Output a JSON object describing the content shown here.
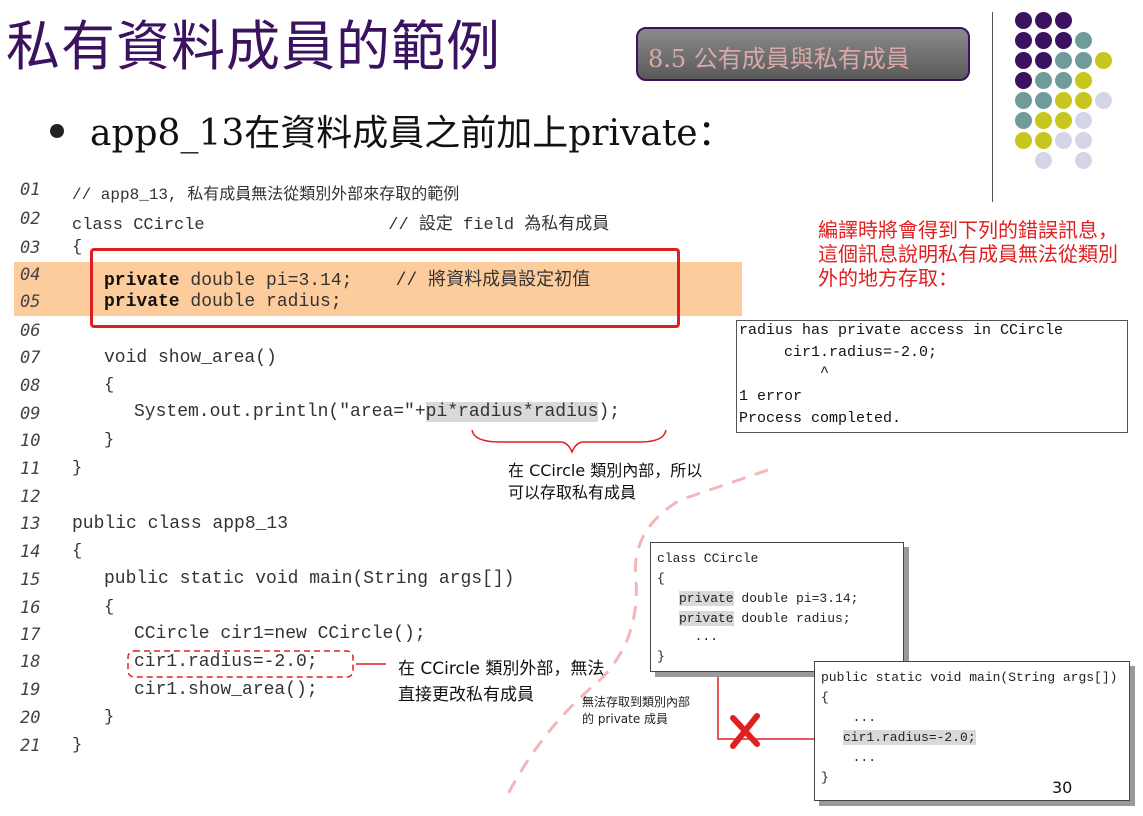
{
  "title": "私有資料成員的範例",
  "section_badge": "8.5  公有成員與私有成員",
  "subtitle": "app8_13在資料成員之前加上private：",
  "code_lines": [
    {
      "num": "01",
      "text": "// app8_13, 私有成員無法從類別外部來存取的範例"
    },
    {
      "num": "02",
      "text": "class CCircle                  // 設定 field 為私有成員"
    },
    {
      "num": "03",
      "text": "{"
    },
    {
      "num": "04",
      "kw": "private",
      "text": " double pi=3.14;    // 將資料成員設定初值"
    },
    {
      "num": "05",
      "kw": "private",
      "text": " double radius;"
    },
    {
      "num": "06",
      "text": ""
    },
    {
      "num": "07",
      "text": "void show_area()"
    },
    {
      "num": "08",
      "text": "{"
    },
    {
      "num": "09",
      "pre": "System.out.println(\"area=\"+",
      "hl": "pi*radius*radius",
      "post": ");"
    },
    {
      "num": "10",
      "text": "}"
    },
    {
      "num": "11",
      "text": "}"
    },
    {
      "num": "12",
      "text": ""
    },
    {
      "num": "13",
      "text": "public class app8_13"
    },
    {
      "num": "14",
      "text": "{"
    },
    {
      "num": "15",
      "text": "public static void main(String args[])"
    },
    {
      "num": "16",
      "text": "{"
    },
    {
      "num": "17",
      "text": "CCircle cir1=new CCircle();"
    },
    {
      "num": "18",
      "text": "cir1.radius=-2.0;"
    },
    {
      "num": "19",
      "text": "cir1.show_area();"
    },
    {
      "num": "20",
      "text": "}"
    },
    {
      "num": "21",
      "text": "}"
    }
  ],
  "error_note": "編譯時將會得到下列的錯誤訊息，這個訊息說明私有成員無法從類別外的地方存取：",
  "error_output": [
    "radius has private access in CCircle",
    "     cir1.radius=-2.0;",
    "         ^",
    "1 error",
    "Process completed."
  ],
  "inside_note_1": "在 CCircle 類別內部，所以",
  "inside_note_2": "可以存取私有成員",
  "outside_note_1": "在 CCircle 類別外部，無法",
  "outside_note_2": "直接更改私有成員",
  "popup_class": {
    "l1": "class CCircle",
    "l2": "{",
    "kw3": "private",
    "l3": " double pi=3.14;",
    "kw4": "private",
    "l4": " double radius;",
    "l5": "  ...",
    "l6": "}"
  },
  "popup_main": {
    "l1": "public static void main(String args[])",
    "l2": "{",
    "l3": "  ...",
    "hl4": "cir1.radius=-2.0;",
    "l5": "  ...",
    "l6": "}"
  },
  "blocked_note_1": "無法存取到類別內部",
  "blocked_note_2": "的 private 成員",
  "page_number": "30",
  "colors": {
    "title": "#3b1260",
    "accent_red": "#e02020",
    "highlight_orange": "#fccc9c",
    "dot_purple": "#3b1260",
    "dot_teal": "#6f9c9a",
    "dot_yellow": "#c6c61e",
    "dot_lavender": "#d5d5e8"
  }
}
